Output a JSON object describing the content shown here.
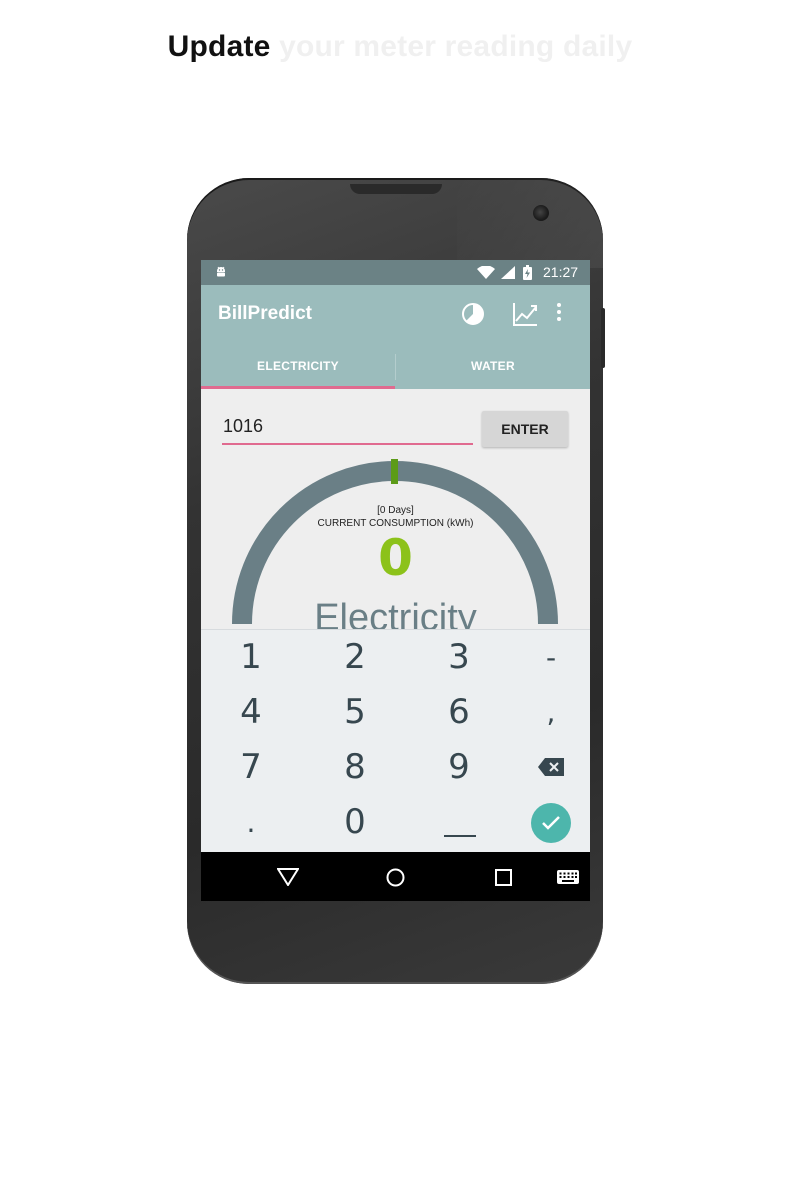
{
  "headline": {
    "strong": "Update",
    "faint": " your meter reading daily"
  },
  "status_bar": {
    "time": "21:27",
    "icons": [
      "android-icon",
      "wifi-icon",
      "signal-icon",
      "battery-charging-icon"
    ]
  },
  "app_bar": {
    "title": "BillPredict",
    "actions": [
      "pie-chart-icon",
      "trend-chart-icon",
      "overflow-menu-icon"
    ]
  },
  "tabs": [
    {
      "label": "ELECTRICITY",
      "selected": true
    },
    {
      "label": "WATER",
      "selected": false
    }
  ],
  "reading": {
    "value": "1016",
    "button_label": "ENTER"
  },
  "gauge": {
    "days": "[0 Days]",
    "label": "CURRENT CONSUMPTION (kWh)",
    "value": "0",
    "name": "Electricity"
  },
  "keypad": {
    "rows": [
      [
        "1",
        "2",
        "3",
        "-"
      ],
      [
        "4",
        "5",
        "6",
        ","
      ],
      [
        "7",
        "8",
        "9",
        "backspace-icon"
      ],
      [
        ".",
        "0",
        "space-icon",
        "done-icon"
      ]
    ]
  },
  "nav_bar": [
    "back-icon",
    "home-icon",
    "recents-icon",
    "keyboard-icon"
  ],
  "colors": {
    "status_bar": "#6b8285",
    "app_bar": "#9bbcbc",
    "accent": "#e06a8f",
    "gauge_arc": "#6a7f86",
    "gauge_value": "#8cc21a",
    "done_key": "#4db6ac"
  }
}
